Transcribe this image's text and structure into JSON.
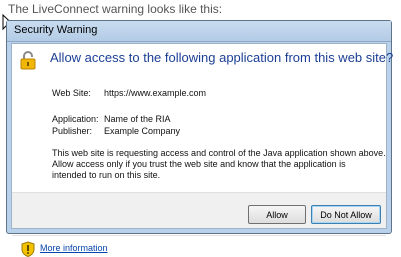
{
  "caption": "The LiveConnect warning looks like this:",
  "dialog": {
    "title": "Security Warning",
    "heading": "Allow access to the following application from this web site?",
    "fields": {
      "website_label": "Web Site:",
      "website_value": "https://www.example.com",
      "application_label": "Application:",
      "application_value": "Name of the RIA",
      "publisher_label": "Publisher:",
      "publisher_value": "Example Company"
    },
    "description_lines": [
      "This web site is requesting access and control of the Java application shown above.",
      "Allow access only if you trust the web site and know that the application is",
      "intended to run on this site."
    ],
    "buttons": {
      "allow": "Allow",
      "deny": "Do Not Allow"
    },
    "more_info_link": "More information"
  },
  "icons": {
    "lock": "lock-icon",
    "shield": "shield-warning-icon",
    "cursor": "mouse-cursor-icon"
  },
  "colors": {
    "heading": "#1c3f95",
    "link": "#0645ad",
    "frame": "#b9d1ea"
  }
}
